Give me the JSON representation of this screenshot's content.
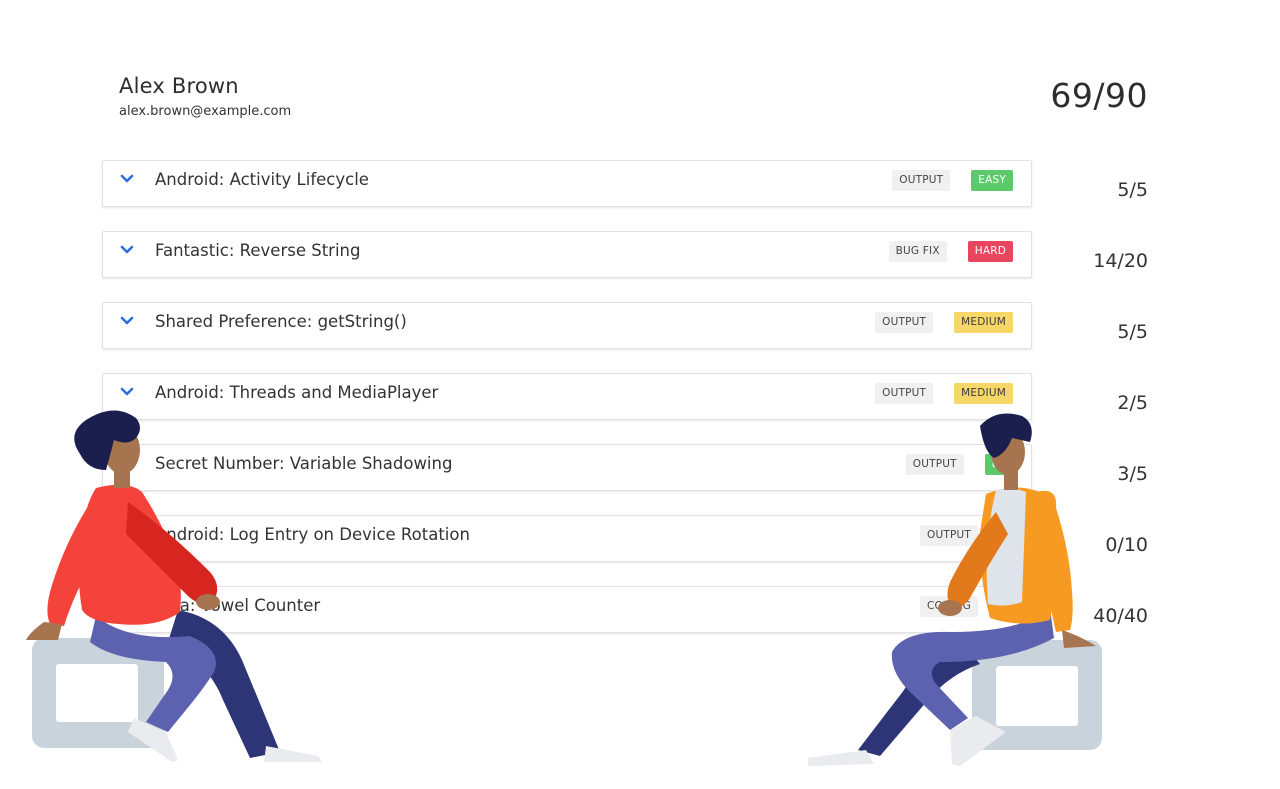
{
  "candidate": {
    "name": "Alex Brown",
    "email": "alex.brown@example.com",
    "total_score": "69/90"
  },
  "questions": [
    {
      "title": "Android: Activity Lifecycle",
      "type": "OUTPUT",
      "difficulty": "EASY",
      "score": "5/5"
    },
    {
      "title": "Fantastic: Reverse String",
      "type": "BUG FIX",
      "difficulty": "HARD",
      "score": "14/20"
    },
    {
      "title": "Shared Preference: getString()",
      "type": "OUTPUT",
      "difficulty": "MEDIUM",
      "score": "5/5"
    },
    {
      "title": "Android: Threads and MediaPlayer",
      "type": "OUTPUT",
      "difficulty": "MEDIUM",
      "score": "2/5"
    },
    {
      "title": "Secret Number: Variable Shadowing",
      "type": "OUTPUT",
      "difficulty": "EA",
      "score": "3/5"
    },
    {
      "title": "Android: Log Entry on Device Rotation",
      "type": "OUTPUT",
      "difficulty": "",
      "score": "0/10"
    },
    {
      "title": "Java: Vowel Counter",
      "type": "CODING",
      "difficulty": "",
      "score": "40/40"
    }
  ],
  "colors": {
    "easy": "#5cc96b",
    "hard": "#e8455f",
    "medium": "#f6d768",
    "chevron": "#2f6fd6"
  },
  "icons": {
    "expand": "chevron-down-icon"
  }
}
